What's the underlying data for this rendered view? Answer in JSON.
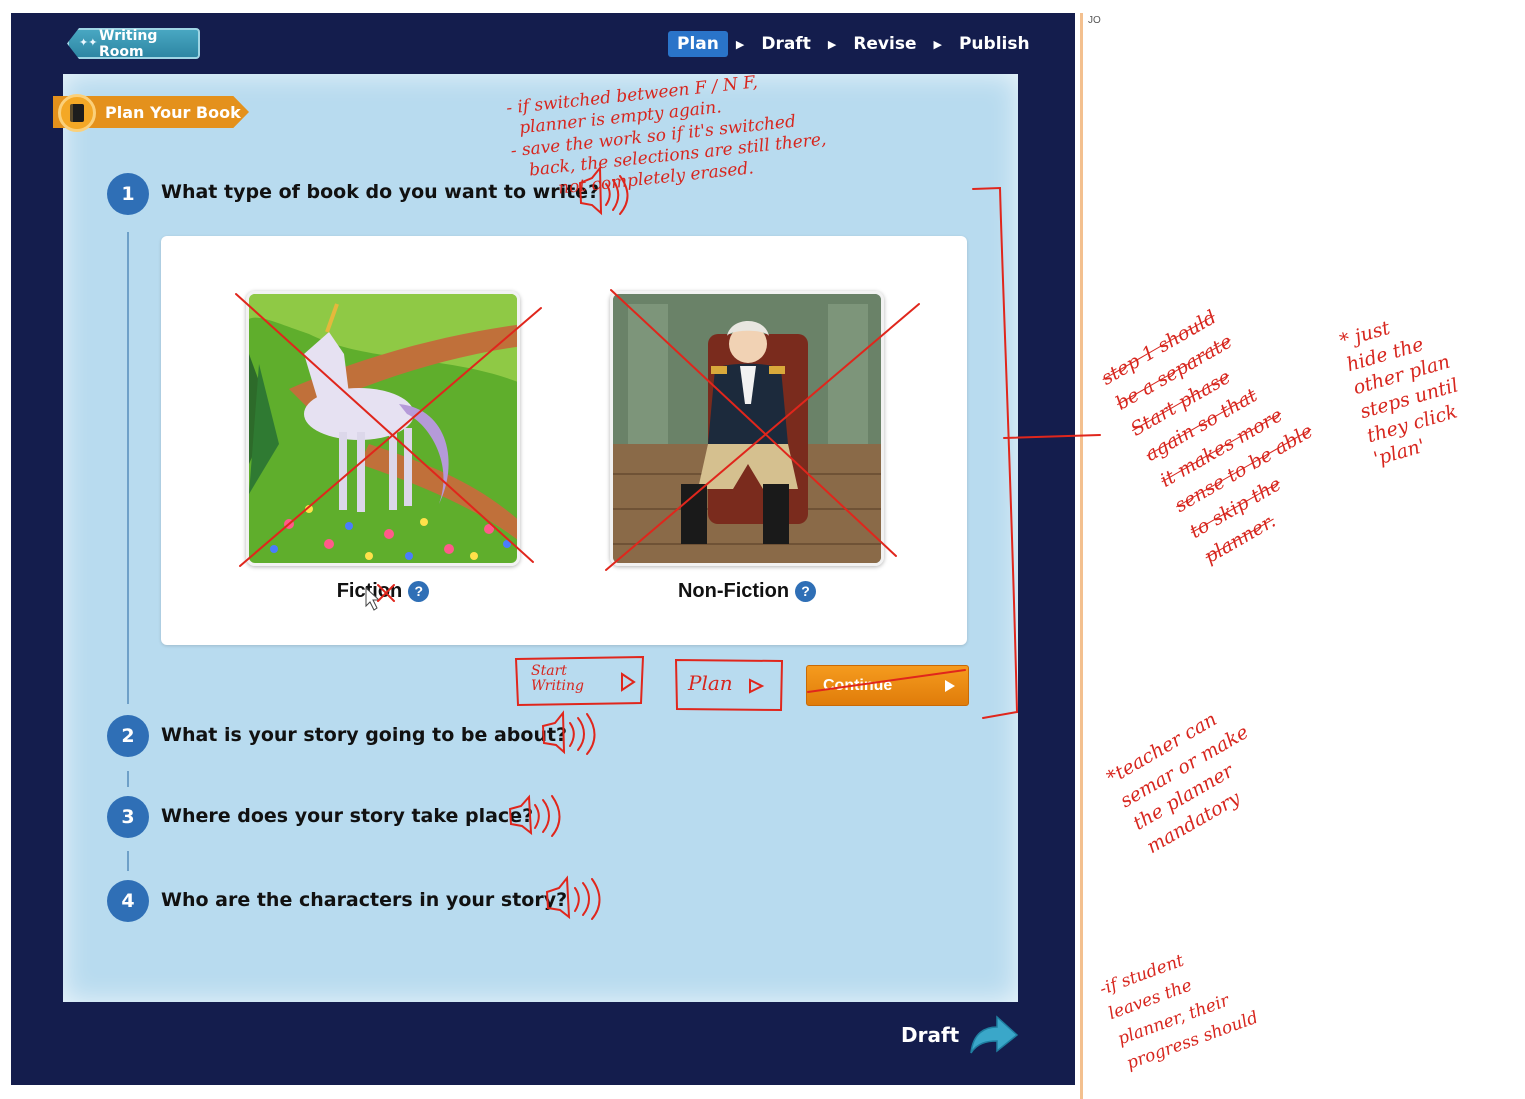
{
  "topbar": {
    "back_label": "Writing Room",
    "steps": [
      "Plan",
      "Draft",
      "Revise",
      "Publish"
    ]
  },
  "panel": {
    "banner": "Plan Your Book",
    "questions": [
      {
        "num": "1",
        "text": "What type of book do you want to write?"
      },
      {
        "num": "2",
        "text": "What is your story going to be about?"
      },
      {
        "num": "3",
        "text": "Where does your story take place?"
      },
      {
        "num": "4",
        "text": "Who are the characters in your story?"
      }
    ],
    "choices": [
      {
        "label": "Fiction",
        "help": "?",
        "image": "unicorn-meadow"
      },
      {
        "label": "Non-Fiction",
        "help": "?",
        "image": "george-washington-portrait"
      }
    ],
    "continue_label": "Continue"
  },
  "footer": {
    "next_label": "Draft"
  },
  "sidebar": {
    "initials": "JO"
  },
  "annotations": {
    "note_top": "- if switched between F / N F,\n  planner is empty again.\n- save the work so if it's switched\n   back, the selections are still there,\n        not completely erased.",
    "start_writing": "Start\nWriting",
    "plan": "Plan",
    "note_step1": "step 1 should\nbe a separate\nStart phase\nagain so that\nit makes more\nsense to be able\nto skip the\nplanner.",
    "note_hide": "* just\nhide the\nother plan\nsteps until\nthey click\n'plan'",
    "note_teacher": "*teacher can\nsemar or make\nthe planner\nmandatory",
    "note_bottom": "-if student\nleaves the\nplanner, their\nprogress should"
  },
  "colors": {
    "frame": "#141d4d",
    "panel": "#b8dbef",
    "accent_blue": "#2f6fb6",
    "orange": "#e4911c",
    "ink_red": "#d7261e"
  }
}
